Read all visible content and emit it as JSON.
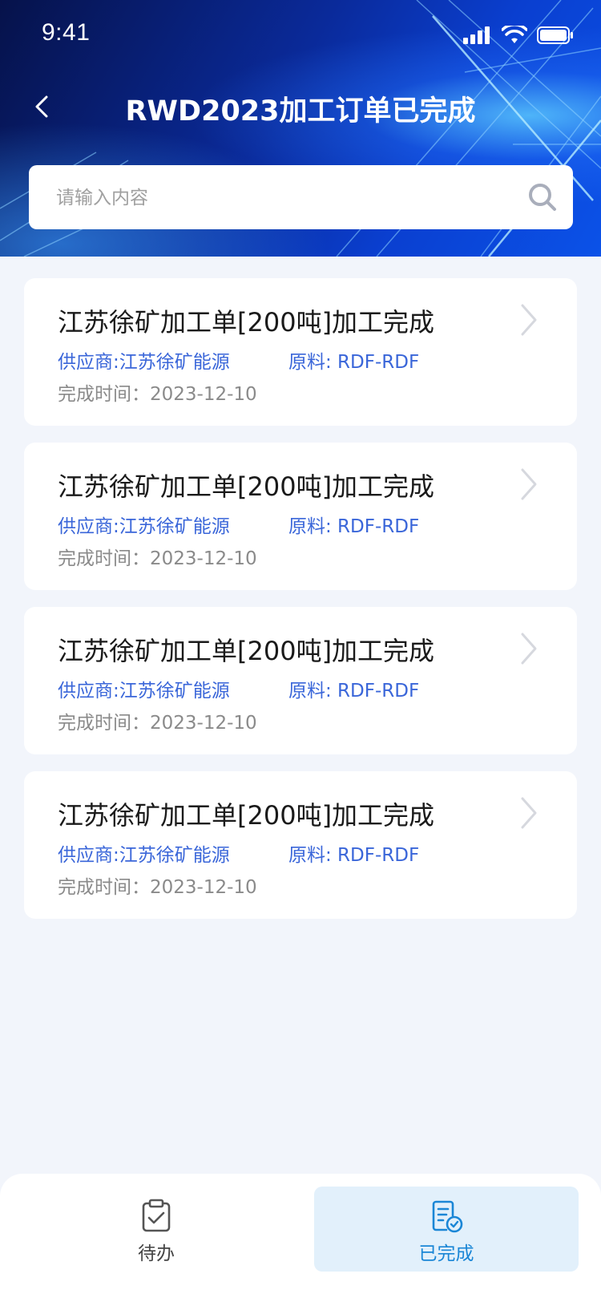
{
  "status_bar": {
    "time": "9:41"
  },
  "header": {
    "title": "RWD2023加工订单已完成",
    "back_icon": "chevron-left-icon"
  },
  "search": {
    "placeholder": "请输入内容",
    "value": "",
    "icon": "search-icon"
  },
  "orders": [
    {
      "title": "江苏徐矿加工单[200吨]加工完成",
      "supplier": "供应商:江苏徐矿能源",
      "material": "原料: RDF-RDF",
      "completed": "完成时间：2023-12-10"
    },
    {
      "title": "江苏徐矿加工单[200吨]加工完成",
      "supplier": "供应商:江苏徐矿能源",
      "material": "原料: RDF-RDF",
      "completed": "完成时间：2023-12-10"
    },
    {
      "title": "江苏徐矿加工单[200吨]加工完成",
      "supplier": "供应商:江苏徐矿能源",
      "material": "原料: RDF-RDF",
      "completed": "完成时间：2023-12-10"
    },
    {
      "title": "江苏徐矿加工单[200吨]加工完成",
      "supplier": "供应商:江苏徐矿能源",
      "material": "原料: RDF-RDF",
      "completed": "完成时间：2023-12-10"
    }
  ],
  "tabbar": {
    "tabs": [
      {
        "label": "待办",
        "icon": "clipboard-check-icon",
        "active": false
      },
      {
        "label": "已完成",
        "icon": "document-check-icon",
        "active": true
      }
    ]
  },
  "colors": {
    "accent": "#3a66d9",
    "active_tab": "#1a86d6",
    "active_tab_bg": "#e2f0fb",
    "page_bg": "#f2f5fb"
  }
}
